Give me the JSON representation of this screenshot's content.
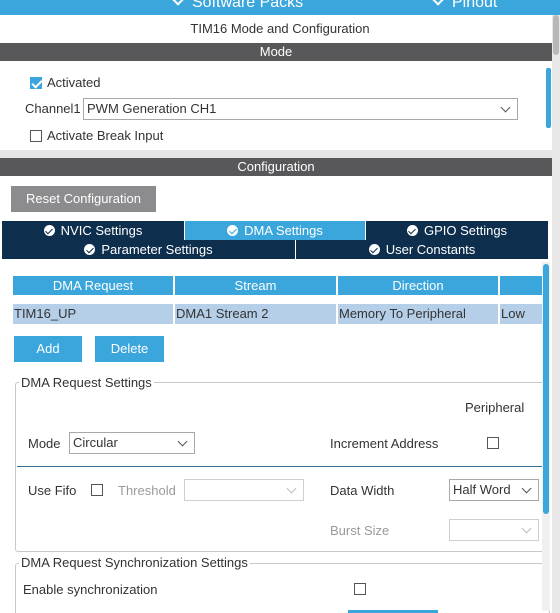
{
  "top_tabs": [
    {
      "label": "Software Packs"
    },
    {
      "label": "Pinout"
    }
  ],
  "title": "TIM16 Mode and Configuration",
  "mode_section": {
    "header": "Mode",
    "activated_label": "Activated",
    "activated_checked": true,
    "channel1_label": "Channel1",
    "channel1_value": "PWM Generation CH1",
    "break_input_label": "Activate Break Input",
    "break_input_checked": false
  },
  "config_section": {
    "header": "Configuration",
    "reset_button": "Reset Configuration",
    "tabs_row1": [
      "NVIC Settings",
      "DMA Settings",
      "GPIO Settings"
    ],
    "tabs_row2": [
      "Parameter Settings",
      "User Constants"
    ],
    "active_tab": "DMA Settings"
  },
  "dma_table": {
    "headers": [
      "DMA Request",
      "Stream",
      "Direction",
      ""
    ],
    "rows": [
      [
        "TIM16_UP",
        "DMA1 Stream 2",
        "Memory To Peripheral",
        "Low"
      ]
    ]
  },
  "actions": {
    "add": "Add",
    "delete": "Delete"
  },
  "dma_request_settings": {
    "legend": "DMA Request Settings",
    "peripheral_header": "Peripheral",
    "mode_label": "Mode",
    "mode_value": "Circular",
    "increment_address_label": "Increment Address",
    "increment_address_checked": false,
    "use_fifo_label": "Use Fifo",
    "use_fifo_checked": false,
    "threshold_label": "Threshold",
    "threshold_value": "",
    "data_width_label": "Data Width",
    "data_width_value": "Half Word",
    "burst_size_label": "Burst Size",
    "burst_size_value": ""
  },
  "sync_settings": {
    "legend": "DMA Request Synchronization Settings",
    "enable_sync_label": "Enable synchronization",
    "enable_sync_checked": false
  },
  "colors": {
    "accent": "#3aa6dc",
    "dark_tab": "#0e2e4e",
    "section_bar": "#58585a",
    "row_selected": "#b6cfe8"
  }
}
